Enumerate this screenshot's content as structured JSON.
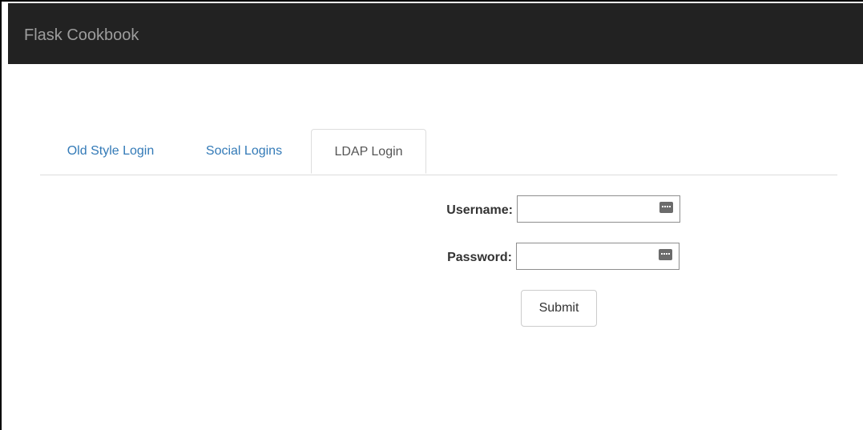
{
  "navbar": {
    "brand": "Flask Cookbook"
  },
  "tabs": [
    {
      "label": "Old Style Login",
      "active": false
    },
    {
      "label": "Social Logins",
      "active": false
    },
    {
      "label": "LDAP Login",
      "active": true
    }
  ],
  "form": {
    "username_label": "Username:",
    "username_value": "",
    "password_label": "Password:",
    "password_value": "",
    "submit_label": "Submit"
  },
  "icons": {
    "autofill": "password-manager-icon"
  },
  "colors": {
    "navbar_bg": "#222222",
    "brand_text": "#9d9d9d",
    "link": "#337ab7",
    "active_tab_text": "#555555"
  }
}
